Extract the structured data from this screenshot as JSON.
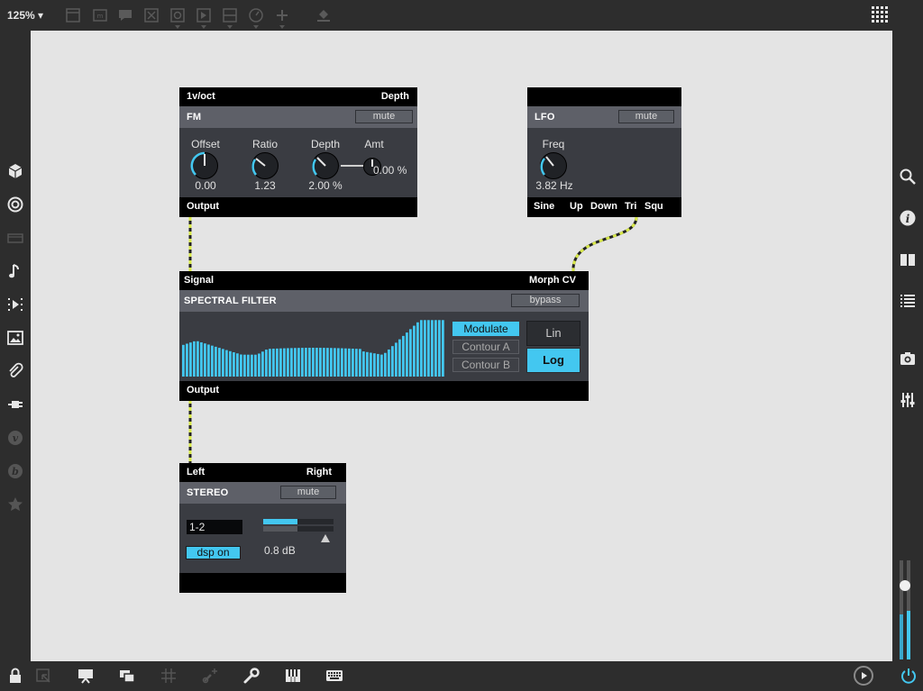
{
  "toolbar": {
    "zoom": "125% ▾"
  },
  "fm": {
    "inlets": {
      "left": "1v/oct",
      "right": "Depth"
    },
    "title": "FM",
    "mute": "mute",
    "knobs": [
      {
        "label": "Offset",
        "value": "0.00"
      },
      {
        "label": "Ratio",
        "value": "1.23"
      },
      {
        "label": "Depth",
        "value": "2.00 %"
      }
    ],
    "amt": {
      "label": "Amt",
      "value": "0.00 %"
    },
    "outlet": "Output"
  },
  "lfo": {
    "title": "LFO",
    "mute": "mute",
    "knob": {
      "label": "Freq",
      "value": "3.82 Hz"
    },
    "outlets": [
      "Sine",
      "Up",
      "Down",
      "Tri",
      "Squ"
    ]
  },
  "spectral": {
    "inlets": {
      "left": "Signal",
      "right": "Morph CV"
    },
    "title": "SPECTRAL FILTER",
    "bypass": "bypass",
    "modes": [
      "Modulate",
      "Contour A",
      "Contour B"
    ],
    "lin": "Lin",
    "log": "Log",
    "outlet": "Output"
  },
  "stereo": {
    "inlets": {
      "left": "Left",
      "right": "Right"
    },
    "title": "STEREO",
    "mute": "mute",
    "channel": "1-2",
    "dsp": "dsp on",
    "gain": "0.8 dB"
  },
  "colors": {
    "accent": "#43c7f0",
    "cable": "#d8e84a"
  }
}
